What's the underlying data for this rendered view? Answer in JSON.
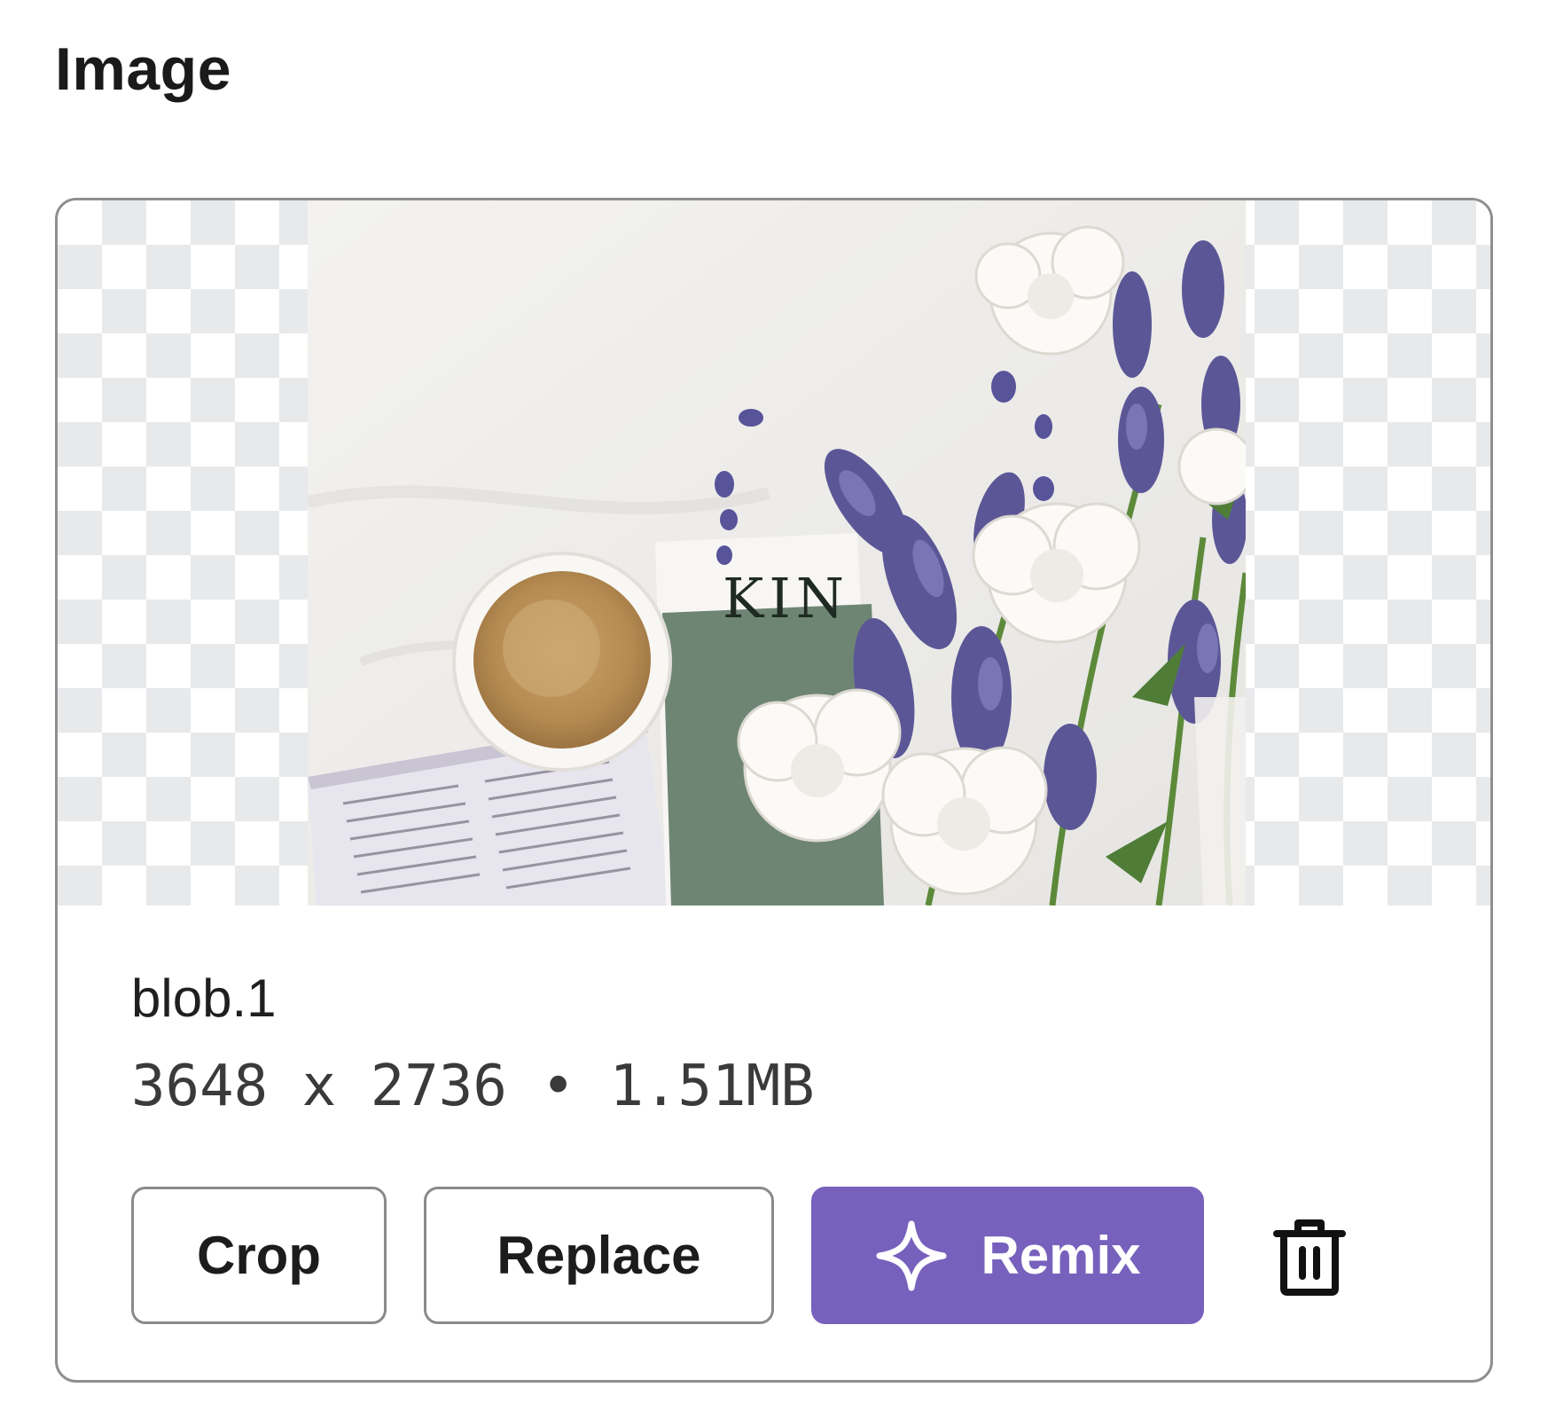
{
  "section": {
    "title": "Image"
  },
  "photo": {
    "cover_text": "KIN"
  },
  "file": {
    "name": "blob.1",
    "meta": "3648 x 2736 • 1.51MB"
  },
  "actions": {
    "crop_label": "Crop",
    "replace_label": "Replace",
    "remix_label": "Remix"
  },
  "icons": {
    "remix": "sparkle-icon",
    "delete": "trash-icon"
  },
  "colors": {
    "accent": "#7761bd",
    "border": "#8f8f8f",
    "checker": "#e8e9eb"
  }
}
